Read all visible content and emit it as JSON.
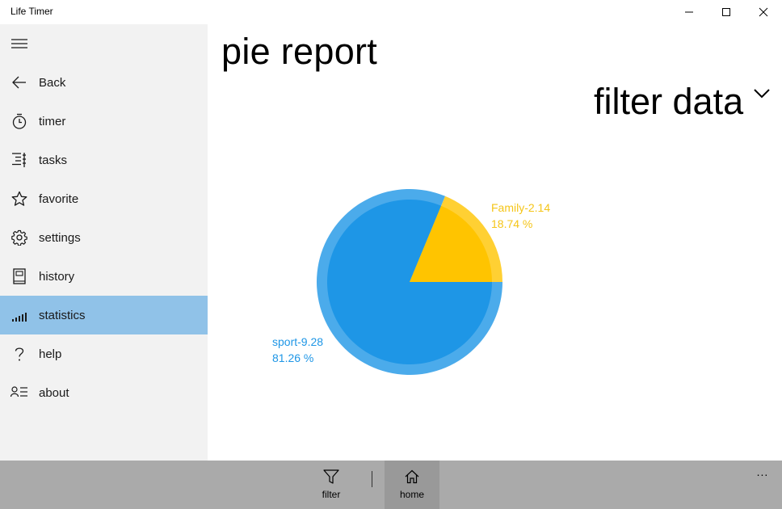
{
  "window": {
    "title": "Life Timer",
    "minimize_icon": "minimize-icon",
    "maximize_icon": "maximize-icon",
    "close_icon": "close-icon"
  },
  "sidebar": {
    "menu_icon": "hamburger-icon",
    "items": [
      {
        "label": "Back",
        "icon": "arrow-left-icon",
        "active": false
      },
      {
        "label": "timer",
        "icon": "stopwatch-icon",
        "active": false
      },
      {
        "label": "tasks",
        "icon": "tasks-list-icon",
        "active": false
      },
      {
        "label": "favorite",
        "icon": "star-icon",
        "active": false
      },
      {
        "label": "settings",
        "icon": "gear-icon",
        "active": false
      },
      {
        "label": "history",
        "icon": "book-icon",
        "active": false
      },
      {
        "label": "statistics",
        "icon": "signal-bars-icon",
        "active": true
      },
      {
        "label": "help",
        "icon": "question-icon",
        "active": false
      },
      {
        "label": "about",
        "icon": "contact-list-icon",
        "active": false
      }
    ],
    "active_color": "#90c2e8"
  },
  "main": {
    "title": "pie report",
    "filter_label": "filter data",
    "filter_icon": "chevron-down-icon"
  },
  "chart_data": {
    "type": "pie",
    "slices": [
      {
        "name": "sport",
        "value": 9.28,
        "percent": 81.26,
        "label_top": "sport-9.28",
        "label_bottom": "81.26 %",
        "color": "#1e96e6"
      },
      {
        "name": "Family",
        "value": 2.14,
        "percent": 18.74,
        "label_top": "Family-2.14",
        "label_bottom": "18.74 %",
        "color": "#ffc400"
      }
    ],
    "label_colors": {
      "sport": "#1e96e6",
      "Family": "#f5c518"
    }
  },
  "appbar": {
    "buttons": [
      {
        "label": "filter",
        "icon": "filter-icon",
        "selected": false
      },
      {
        "label": "home",
        "icon": "home-icon",
        "selected": true
      }
    ],
    "more_label": "..."
  }
}
